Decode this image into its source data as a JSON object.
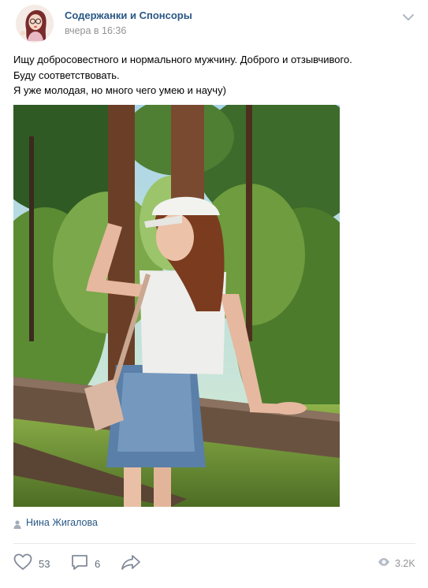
{
  "post": {
    "author_name": "Содержанки и Спонсоры",
    "date": "вчера в 16:36",
    "text_lines": [
      "Ищу добросовестного и нормального мужчину. Доброго и отзывчивого.",
      "Буду соответствовать.",
      "Я уже молодая, но много чего умею и научу)"
    ],
    "photo_author": "Нина Жигалова"
  },
  "actions": {
    "likes": "53",
    "comments": "6",
    "views": "3.2K"
  },
  "icons": {
    "more": "chevron-down-icon",
    "author": "person-icon",
    "like": "heart-icon",
    "comment": "comment-icon",
    "share": "share-icon",
    "views": "eye-icon"
  },
  "colors": {
    "link": "#2a5885",
    "meta": "#939393",
    "action_icon": "#828a99",
    "divider": "#e7e8ec"
  }
}
